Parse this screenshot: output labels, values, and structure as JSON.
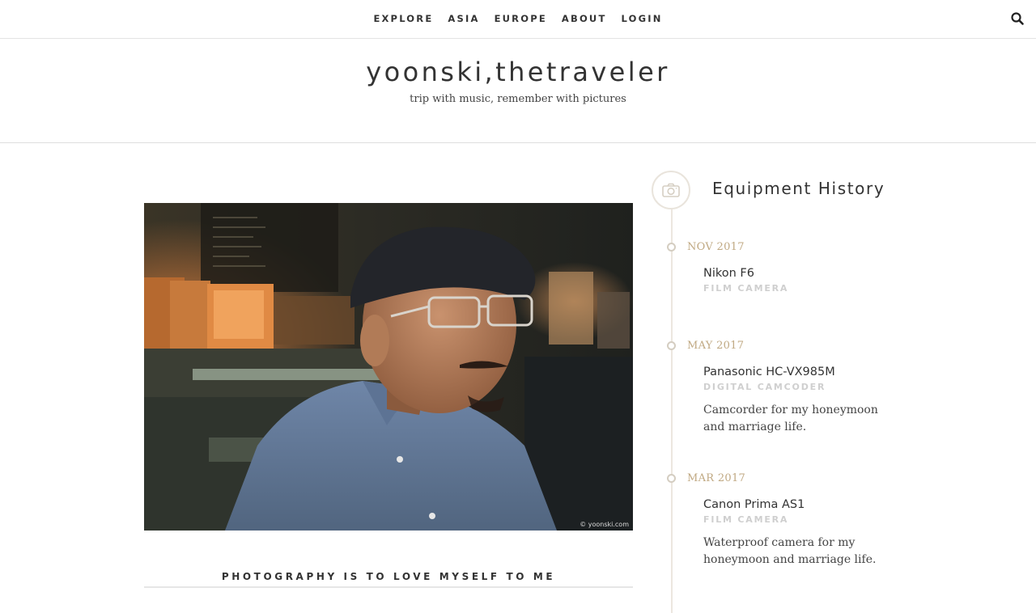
{
  "nav": {
    "items": [
      "EXPLORE",
      "ASIA",
      "EUROPE",
      "ABOUT",
      "LOGIN"
    ],
    "search_icon": "search-icon"
  },
  "site": {
    "title": "yoonski,thetraveler",
    "tagline": "trip with music, remember with pictures"
  },
  "photo": {
    "credit": "© yoonski.com",
    "caption": "PHOTOGRAPHY IS TO LOVE MYSELF TO ME"
  },
  "equipment": {
    "heading": "Equipment History",
    "icon": "camera-icon",
    "entries": [
      {
        "date": "NOV 2017",
        "name": "Nikon F6",
        "type": "FILM CAMERA",
        "description": ""
      },
      {
        "date": "MAY 2017",
        "name": "Panasonic HC-VX985M",
        "type": "DIGITAL CAMCODER",
        "description": "Camcorder for my honeymoon and marriage life."
      },
      {
        "date": "MAR 2017",
        "name": "Canon Prima AS1",
        "type": "FILM CAMERA",
        "description": "Waterproof camera for my honeymoon and marriage life."
      }
    ]
  },
  "colors": {
    "accent_date": "#c0a983",
    "muted_type": "#cfcfcf",
    "timeline": "#ece7df"
  }
}
